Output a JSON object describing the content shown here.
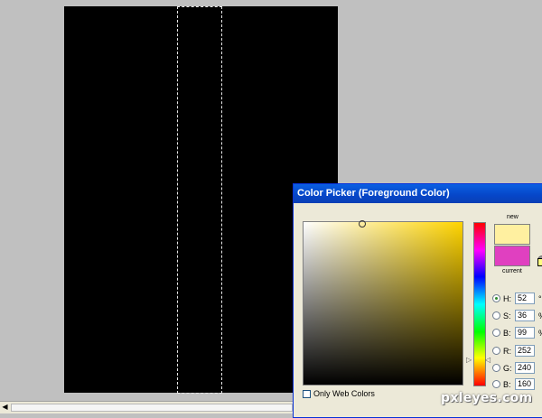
{
  "dialog": {
    "title": "Color Picker (Foreground Color)",
    "new_label": "new",
    "current_label": "current",
    "new_color": "#fff0a0",
    "current_color": "#e040c0",
    "only_web_colors_label": "Only Web Colors",
    "only_web_colors_checked": false
  },
  "hsb": [
    {
      "label": "H:",
      "value": "52",
      "unit": "°",
      "selected": true
    },
    {
      "label": "S:",
      "value": "36",
      "unit": "%",
      "selected": false
    },
    {
      "label": "B:",
      "value": "99",
      "unit": "%",
      "selected": false
    }
  ],
  "rgb": [
    {
      "label": "R:",
      "value": "252",
      "selected": false
    },
    {
      "label": "G:",
      "value": "240",
      "selected": false
    },
    {
      "label": "B:",
      "value": "160",
      "selected": false
    }
  ],
  "watermark": "pxleyes.com",
  "colors": {
    "workspace": "#c0c0c0",
    "canvas": "#000000",
    "titlebar": "#0a4fd0"
  }
}
